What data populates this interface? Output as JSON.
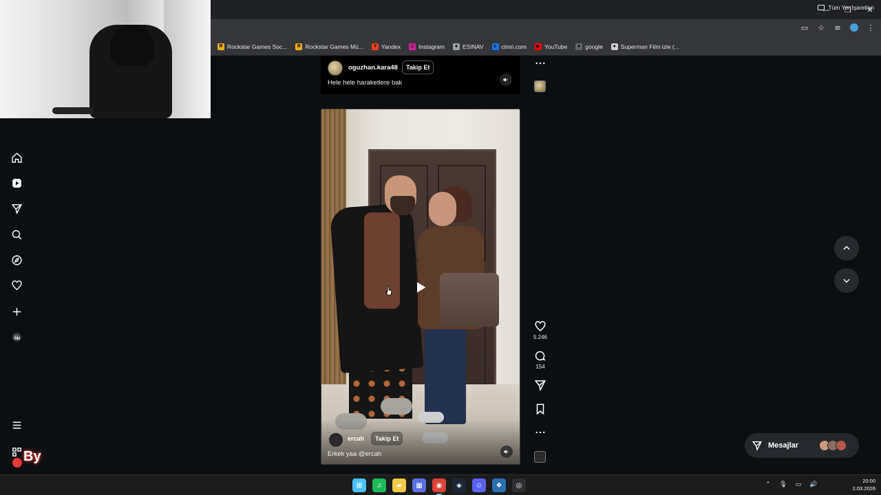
{
  "browser": {
    "window_controls": {
      "minimize": "—",
      "restore": "❐",
      "close": "✕"
    },
    "bookmarks": [
      {
        "label": "Rockstar Games Soc...",
        "icon": "rockstar-icon",
        "color": "#fcaf17",
        "glyph": "R"
      },
      {
        "label": "Rockstar Games Mü...",
        "icon": "rockstar-icon",
        "color": "#fcaf17",
        "glyph": "R"
      },
      {
        "label": "Yandex",
        "icon": "yandex-icon",
        "color": "#fc3f1d",
        "glyph": "Y"
      },
      {
        "label": "Instagram",
        "icon": "instagram-icon",
        "color": "#d6249f",
        "glyph": "◎"
      },
      {
        "label": "ESINAV",
        "icon": "globe-icon",
        "color": "#9aa0a6",
        "glyph": "●"
      },
      {
        "label": "cimri.com",
        "icon": "cimri-icon",
        "color": "#1a73e8",
        "glyph": "c"
      },
      {
        "label": "YouTube",
        "icon": "youtube-icon",
        "color": "#ff0000",
        "glyph": "▶"
      },
      {
        "label": "google",
        "icon": "globe-icon",
        "color": "#5f6368",
        "glyph": "●"
      },
      {
        "label": "Superman Film izle (...",
        "icon": "superman-icon",
        "color": "#cccccc",
        "glyph": "●"
      }
    ],
    "all_bookmarks": "Tüm Yer İşaretleri"
  },
  "sidebar": {
    "items": [
      {
        "name": "home-icon"
      },
      {
        "name": "reels-icon"
      },
      {
        "name": "send-icon"
      },
      {
        "name": "search-icon"
      },
      {
        "name": "explore-icon"
      },
      {
        "name": "heart-icon"
      },
      {
        "name": "create-icon"
      },
      {
        "name": "profile-avatar-icon"
      }
    ],
    "menu": "more-menu-icon",
    "meta": "apps-grid-icon",
    "logo_text": "By"
  },
  "post_top": {
    "username": "oguzhan.kara48",
    "follow": "Takip Et",
    "caption": "Hele hele haraketlere bak"
  },
  "post_main": {
    "username": "ercah",
    "follow": "Takip Et",
    "caption": "Erkek yaa @ercah",
    "likes": "5.246",
    "comments": "154"
  },
  "messages": {
    "label": "Mesajlar"
  },
  "taskbar": {
    "apps": [
      {
        "name": "windows-start-icon",
        "color": "#4cc2ff",
        "glyph": "⊞"
      },
      {
        "name": "spotify-icon",
        "color": "#1db954",
        "glyph": "♫"
      },
      {
        "name": "file-explorer-icon",
        "color": "#f7c948",
        "glyph": "▰"
      },
      {
        "name": "store-icon",
        "color": "#5b6ee1",
        "glyph": "▦"
      },
      {
        "name": "chrome-icon",
        "color": "#db4437",
        "glyph": "◉"
      },
      {
        "name": "steam-icon",
        "color": "#1b2838",
        "glyph": "◈"
      },
      {
        "name": "discord-icon",
        "color": "#5865f2",
        "glyph": "☺"
      },
      {
        "name": "app-icon",
        "color": "#2a6fb0",
        "glyph": "❖"
      },
      {
        "name": "obs-icon",
        "color": "#302e31",
        "glyph": "◎"
      }
    ],
    "time": "20:00",
    "date": "2.03.2026"
  }
}
